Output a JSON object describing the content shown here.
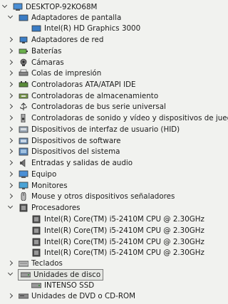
{
  "tree": {
    "root": "DESKTOP-92KO68M",
    "display_adapters": {
      "label": "Adaptadores de pantalla",
      "children": [
        "Intel(R) HD Graphics 3000"
      ]
    },
    "categories_a": [
      {
        "label": "Adaptadores de red",
        "icon": "network-adapter-icon"
      },
      {
        "label": "Baterías",
        "icon": "battery-icon"
      },
      {
        "label": "Cámaras",
        "icon": "camera-icon"
      },
      {
        "label": "Colas de impresión",
        "icon": "printer-icon"
      },
      {
        "label": "Controladoras ATA/ATAPI IDE",
        "icon": "ide-controller-icon"
      },
      {
        "label": "Controladoras de almacenamiento",
        "icon": "storage-controller-icon"
      },
      {
        "label": "Controladoras de bus serie universal",
        "icon": "usb-icon"
      },
      {
        "label": "Controladoras de sonido y vídeo y dispositivos de juego",
        "icon": "speaker-icon"
      },
      {
        "label": "Dispositivos de interfaz de usuario (HID)",
        "icon": "hid-icon"
      },
      {
        "label": "Dispositivos de software",
        "icon": "software-device-icon"
      },
      {
        "label": "Dispositivos del sistema",
        "icon": "system-device-icon"
      },
      {
        "label": "Entradas y salidas de audio",
        "icon": "audio-io-icon"
      },
      {
        "label": "Equipo",
        "icon": "computer-icon"
      },
      {
        "label": "Monitores",
        "icon": "monitor-icon"
      },
      {
        "label": "Mouse y otros dispositivos señaladores",
        "icon": "mouse-icon"
      }
    ],
    "processors": {
      "label": "Procesadores",
      "children": [
        "Intel(R) Core(TM) i5-2410M CPU @ 2.30GHz",
        "Intel(R) Core(TM) i5-2410M CPU @ 2.30GHz",
        "Intel(R) Core(TM) i5-2410M CPU @ 2.30GHz",
        "Intel(R) Core(TM) i5-2410M CPU @ 2.30GHz"
      ]
    },
    "keyboards": "Teclados",
    "disk_drives": {
      "label": "Unidades de disco",
      "children": [
        "INTENSO SSD"
      ]
    },
    "dvd": "Unidades de DVD o CD-ROM"
  },
  "colors": {
    "selection_border": "#7a7a7a",
    "background": "#f1f2ef",
    "icon_blue": "#2f6fb3"
  }
}
